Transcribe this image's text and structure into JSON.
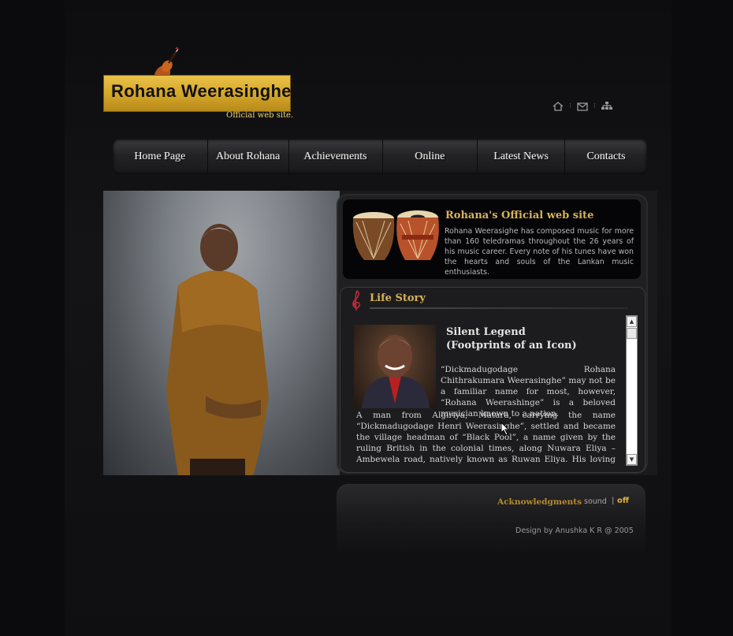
{
  "site": {
    "logo_text": "Rohana Weerasinghe",
    "tagline": "Official web site."
  },
  "top_icons": [
    "home-icon",
    "mail-icon",
    "sitemap-icon"
  ],
  "nav": {
    "items": [
      {
        "label": "Home Page"
      },
      {
        "label": "About Rohana"
      },
      {
        "label": "Achievements"
      },
      {
        "label": "Online"
      },
      {
        "label": "Latest News"
      },
      {
        "label": "Contacts"
      }
    ]
  },
  "intro": {
    "title": "Rohana's Official web site",
    "text": "Rohana Weerasighe has composed music for more than 160 teledramas throughout the 26 years of his music career. Every note of his tunes have won the hearts and souls of the Lankan music enthusiasts."
  },
  "story": {
    "section_title": "Life Story",
    "headline_line1": "Silent Legend",
    "headline_line2": "(Footprints of an Icon)",
    "lead": "“Dickmadugodage Rohana Chithrakumara Weerasinghe” may not be a familiar name for most, however, “Rohana Weerashinge” is a beloved musician known to a nation.",
    "body": "A man from Algiriya, Matara, carrying the name “Dickmadugodage Henri Weerasinghe”, settled and became the village headman of “Black Pool”, a name given by the ruling British in the colonial times, along Nuwara Eliya – Ambewela road, natively known as Ruwan Eliya. His loving wife Sepalin"
  },
  "footer": {
    "acknowledgments": "Acknowledgments",
    "sound_label": "sound",
    "sound_sep": "|",
    "sound_off": "off",
    "design_credit": "Design by Anushka K R @ 2005"
  },
  "colors": {
    "accent_gold": "#d9b25a",
    "logo_gold": "#d6a829",
    "background": "#0b0b0d"
  }
}
